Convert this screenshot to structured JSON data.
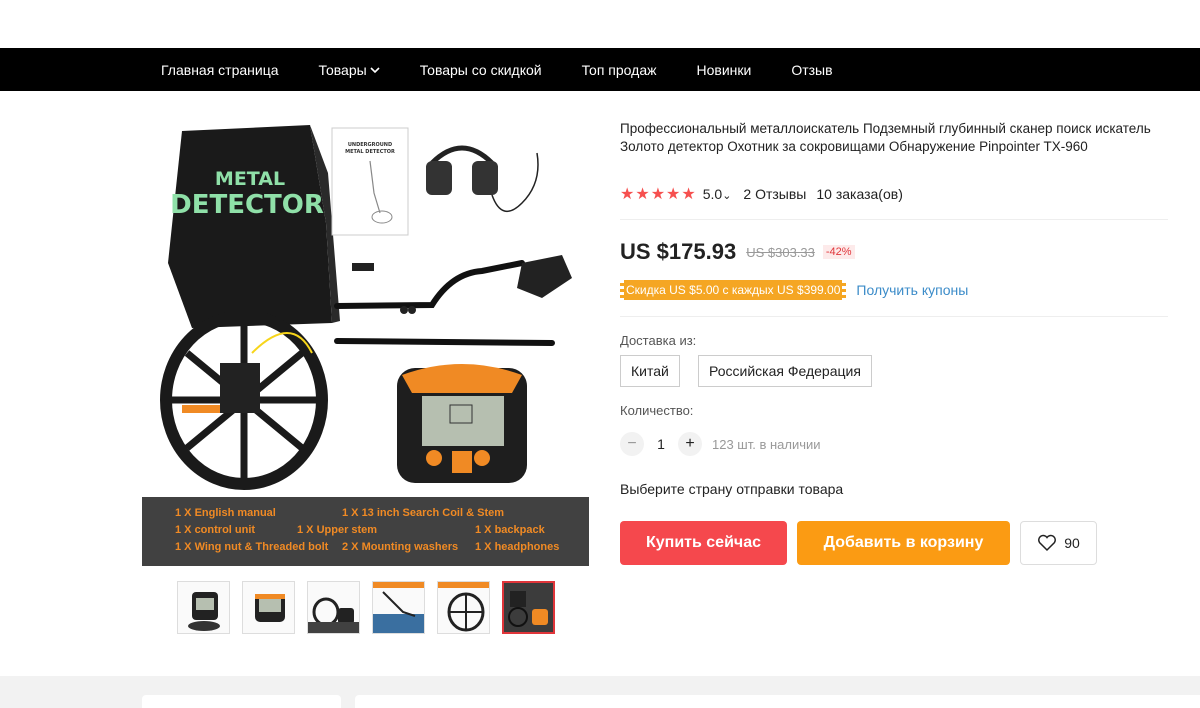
{
  "nav": {
    "items": [
      {
        "label": "Главная страница"
      },
      {
        "label": "Товары",
        "has_dropdown": true
      },
      {
        "label": "Товары со скидкой"
      },
      {
        "label": "Топ продаж"
      },
      {
        "label": "Новинки"
      },
      {
        "label": "Отзыв"
      }
    ]
  },
  "gallery": {
    "main_image": {
      "bag_text_line1": "METAL",
      "bag_text_line2": "DETECTOR",
      "manual_text_line1": "UNDERGROUND",
      "manual_text_line2": "METAL DETECTOR",
      "captions": [
        "1 X English manual",
        "1 X 13 inch Search Coil & Stem",
        "1 X control unit",
        "1 X Upper stem",
        "1 X backpack",
        "1 X Wing nut & Threaded bolt",
        "2 X Mounting washers",
        "1 X headphones"
      ]
    },
    "thumbnails_count": 6,
    "active_thumbnail": 6
  },
  "product": {
    "title": "Профессиональный металлоискатель Подземный глубинный сканер поиск искатель Золото детектор Охотник за сокровищами Обнаружение Pinpointer TX-960",
    "rating": "5.0",
    "rating_chevron": "⌄",
    "reviews": "2 Отзывы",
    "orders": "10 заказа(ов)",
    "price": "US $175.93",
    "old_price": "US $303.33",
    "discount": "-42%",
    "coupon": "Скидка US $5.00 с каждых US $399.00",
    "coupon_link": "Получить купоны",
    "shipping_label": "Доставка из:",
    "shipping_options": [
      "Китай",
      "Российская Федерация"
    ],
    "quantity_label": "Количество:",
    "quantity": "1",
    "stock": "123 шт. в наличии",
    "choose_country": "Выберите страну отправки товара",
    "buy_now": "Купить сейчас",
    "add_to_cart": "Добавить в корзину",
    "wishlist_count": "90"
  },
  "colors": {
    "nav_bg": "#000000",
    "price_star": "#f6504f",
    "buy_button": "#f5484d",
    "cart_button": "#fb9b13",
    "coupon_bg": "#f5a623",
    "link": "#3c8cc9",
    "caption_text": "#f08a24",
    "bag_text": "#8fe0a8"
  }
}
